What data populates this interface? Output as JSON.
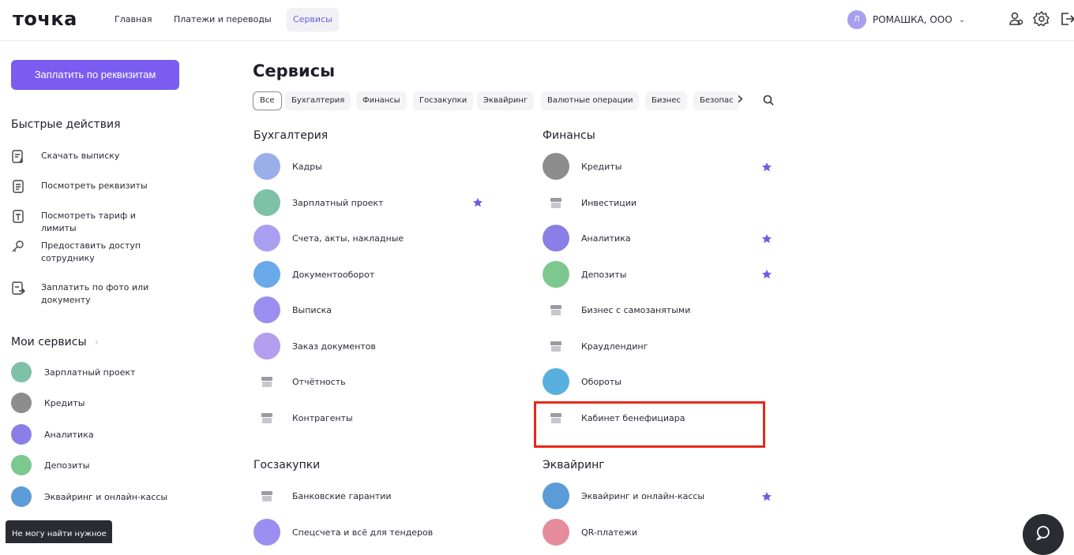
{
  "header": {
    "logo": "точка",
    "nav": [
      "Главная",
      "Платежи и переводы",
      "Сервисы"
    ],
    "company_initial": "Л",
    "company": "РОМАШКА, ООО",
    "chevron": "⌄"
  },
  "sidebar": {
    "pay_button": "Заплатить по реквизитам",
    "quick_title": "Быстрые действия",
    "quick": [
      {
        "label": "Скачать выписку",
        "icon": "download-statement-icon"
      },
      {
        "label": "Посмотреть реквизиты",
        "icon": "details-icon"
      },
      {
        "label": "Посмотреть тариф и лимиты",
        "icon": "tariff-icon"
      },
      {
        "label": "Предоставить доступ сотруднику",
        "icon": "key-icon"
      },
      {
        "label": "Заплатить по фото или документу",
        "icon": "photo-pay-icon"
      }
    ],
    "my_services_title": "Мои сервисы",
    "my_services_chevron": "›",
    "my_services": [
      {
        "label": "Зарплатный проект",
        "color": "#7ec0a8"
      },
      {
        "label": "Кредиты",
        "color": "#8d8d8d"
      },
      {
        "label": "Аналитика",
        "color": "#8a7fe6"
      },
      {
        "label": "Депозиты",
        "color": "#7cc88f"
      },
      {
        "label": "Эквайринг и онлайн-кассы",
        "color": "#5b9bd8"
      }
    ],
    "toast": "Не могу найти нужное"
  },
  "main": {
    "title": "Сервисы",
    "filters": [
      "Все",
      "Бухгалтерия",
      "Финансы",
      "Госзакупки",
      "Эквайринг",
      "Валютные операции",
      "Бизнес",
      "Безопас"
    ],
    "filters_next": "›",
    "accounting": {
      "title": "Бухгалтерия",
      "items": [
        {
          "label": "Кадры",
          "color": "#9aaee8",
          "star": false
        },
        {
          "label": "Зарплатный проект",
          "color": "#7ec0a8",
          "star": true
        },
        {
          "label": "Счета, акты, накладные",
          "color": "#a99ff0",
          "star": false
        },
        {
          "label": "Документооборот",
          "color": "#6aa9e8",
          "star": false
        },
        {
          "label": "Выписка",
          "color": "#9a8ff0",
          "star": false
        },
        {
          "label": "Заказ документов",
          "color": "#b39fee",
          "star": false
        },
        {
          "label": "Отчётность",
          "color": "store",
          "star": false
        },
        {
          "label": "Контрагенты",
          "color": "store",
          "star": false
        }
      ]
    },
    "finance": {
      "title": "Финансы",
      "items": [
        {
          "label": "Кредиты",
          "color": "#8d8d8d",
          "star": true
        },
        {
          "label": "Инвестиции",
          "color": "store",
          "star": false
        },
        {
          "label": "Аналитика",
          "color": "#8a7fe6",
          "star": true
        },
        {
          "label": "Депозиты",
          "color": "#7cc88f",
          "star": true
        },
        {
          "label": "Бизнес с самозанятыми",
          "color": "store",
          "star": false
        },
        {
          "label": "Краудлендинг",
          "color": "store",
          "star": false
        },
        {
          "label": "Обороты",
          "color": "#5ab0dc",
          "star": false
        },
        {
          "label": "Кабинет бенефициара",
          "color": "store",
          "star": false
        }
      ]
    },
    "goszakupki": {
      "title": "Госзакупки",
      "items": [
        {
          "label": "Банковские гарантии",
          "color": "store"
        },
        {
          "label": "Спецсчета и всё для тендеров",
          "color": "#9a8ff0"
        }
      ]
    },
    "acquiring": {
      "title": "Эквайринг",
      "items": [
        {
          "label": "Эквайринг и онлайн-кассы",
          "color": "#5b9bd8",
          "star": true
        },
        {
          "label": "QR-платежи",
          "color": "#e68c9a",
          "star": false
        }
      ]
    }
  },
  "colors": {
    "accent": "#7a5cf0",
    "star": "#6b5de4",
    "highlight": "#e52a1a"
  }
}
